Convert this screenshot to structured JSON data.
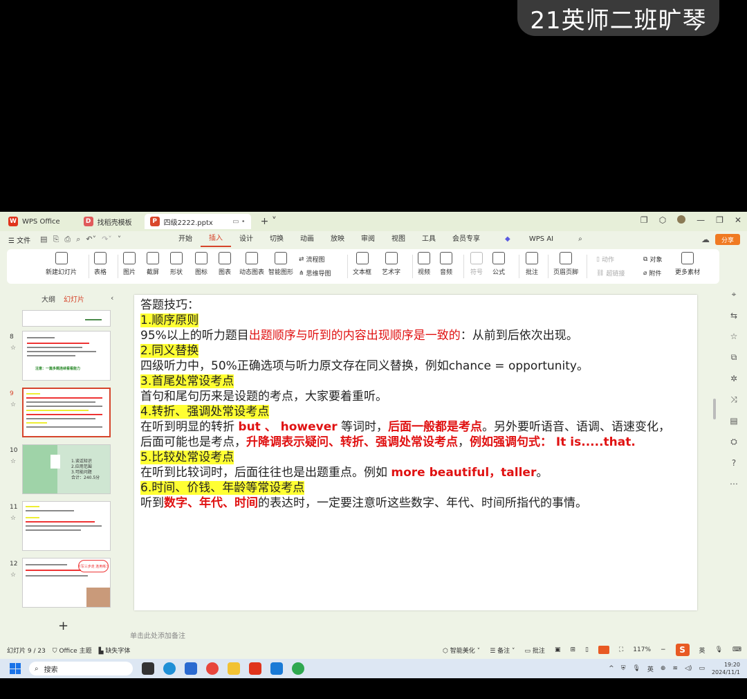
{
  "overlay": {
    "caption": "21英师二班旷琴"
  },
  "tabs": [
    {
      "label": "WPS Office",
      "icon": "wps-logo-icon"
    },
    {
      "label": "找稻壳模板",
      "icon": "docer-icon"
    },
    {
      "label": "四级2222.pptx",
      "icon": "pptx-file-icon"
    }
  ],
  "menu": {
    "file": "文件",
    "items": [
      "开始",
      "插入",
      "设计",
      "切换",
      "动画",
      "放映",
      "审阅",
      "视图",
      "工具",
      "会员专享"
    ],
    "active": "插入",
    "wps_ai": "WPS AI",
    "share": "分享"
  },
  "ribbon": {
    "buttons": [
      "新建幻灯片",
      "表格",
      "图片",
      "截屏",
      "形状",
      "图标",
      "图表",
      "动态图表",
      "智能图形",
      "流程图",
      "思维导图",
      "文本框",
      "艺术字",
      "视频",
      "音频",
      "符号",
      "公式",
      "批注",
      "页眉页脚",
      "动作",
      "超链接",
      "对象",
      "附件",
      "更多素材"
    ],
    "disabled": [
      "符号",
      "动作",
      "超链接"
    ]
  },
  "sidepanel": {
    "tab_outline": "大纲",
    "tab_slides": "幻灯片",
    "thumb_numbers": [
      "8",
      "9",
      "10",
      "11",
      "12"
    ],
    "selected": "9",
    "thumb10": {
      "lines": [
        "1.谈话知识",
        "2.应用范围",
        "3.可能问题",
        "合计：240.5分"
      ]
    },
    "thumb8_title": "注意：一篇多题连续看看能力",
    "thumb12_bubble": "听写三步走 连用练习"
  },
  "slide": {
    "title": "答题技巧：",
    "h1": "1.顺序原则",
    "p1_a": "95%以上的听力题目",
    "p1_b": "出题顺序与听到的内容出现顺序是一致的",
    "p1_c": "：从前到后依次出现。",
    "h2": "2.同义替换",
    "p2": "四级听力中，50%正确选项与听力原文存在同义替换，例如chance = opportunity。",
    "h3": "3.首尾处常设考点",
    "p3": "首句和尾句历来是设题的考点，大家要着重听。",
    "h4": "4.转折、强调处常设考点",
    "p4_a": "在听到明显的转折 ",
    "p4_b": "but 、 however",
    "p4_c": " 等词时，",
    "p4_d": "后面一般都是考点",
    "p4_e": "。另外要听语音、语调、语速变化，",
    "p4_f": "后面可能也是考点，",
    "p4_g": "升降调表示疑问、转折、强调处常设考点",
    "p4_h": "，",
    "p4_i": "例如强调句式： It is.....that.",
    "h5": "5.比较处常设考点",
    "p5_a": "在听到比较词时，后面往往也是出题重点。例如 ",
    "p5_b": "more beautiful，taller",
    "p5_c": "。",
    "h6": "6.时间、价钱、年龄等常设考点",
    "p6_a": "听到",
    "p6_b": "数字、年代、时间",
    "p6_c": "的表达时，一定要注意听这些数字、年代、时间所指代的事情。"
  },
  "notes_placeholder": "单击此处添加备注",
  "status": {
    "slide_count": "幻灯片 9 / 23",
    "theme": "Office 主题",
    "missing_font": "缺失字体",
    "beautify": "智能美化",
    "notes": "备注",
    "comments": "批注",
    "zoom": "117%",
    "ime": "S",
    "ime_lang": "英"
  },
  "taskbar": {
    "search_placeholder": "搜索",
    "time": "19:20",
    "date": "2024/11/1",
    "tray_ime": "英"
  },
  "colors": {
    "accent": "#d6442b",
    "highlight": "#ffff33",
    "emphasis": "#e01212",
    "window_bg": "#eef3e6"
  }
}
